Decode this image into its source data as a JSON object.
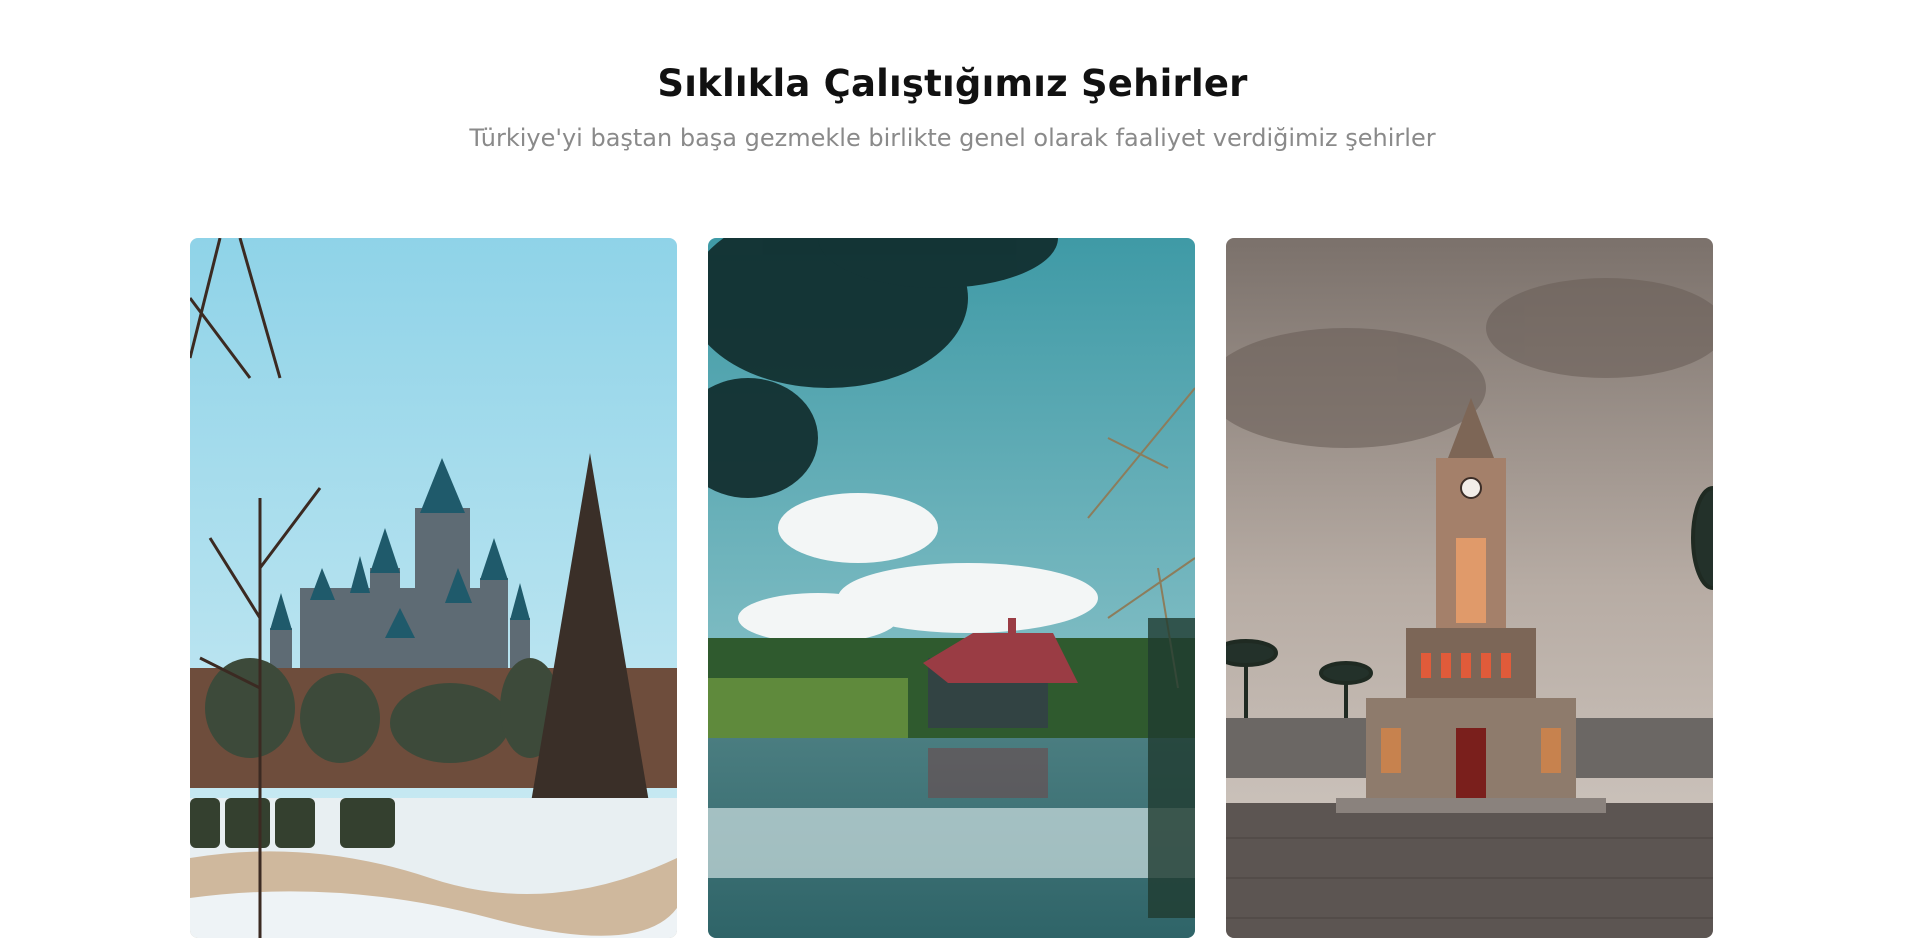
{
  "section": {
    "title": "Sıklıkla Çalıştığımız Şehirler",
    "subtitle": "Türkiye'yi baştan başa gezmekle birlikte genel olarak faaliyet verdiğimiz şehirler"
  },
  "cards": [
    {
      "image": "castle-park-winter-image"
    },
    {
      "image": "lake-house-forest-image"
    },
    {
      "image": "clock-tower-square-image"
    }
  ],
  "colors": {
    "title": "#111111",
    "subtitle": "#8a8a8a",
    "background": "#ffffff"
  }
}
